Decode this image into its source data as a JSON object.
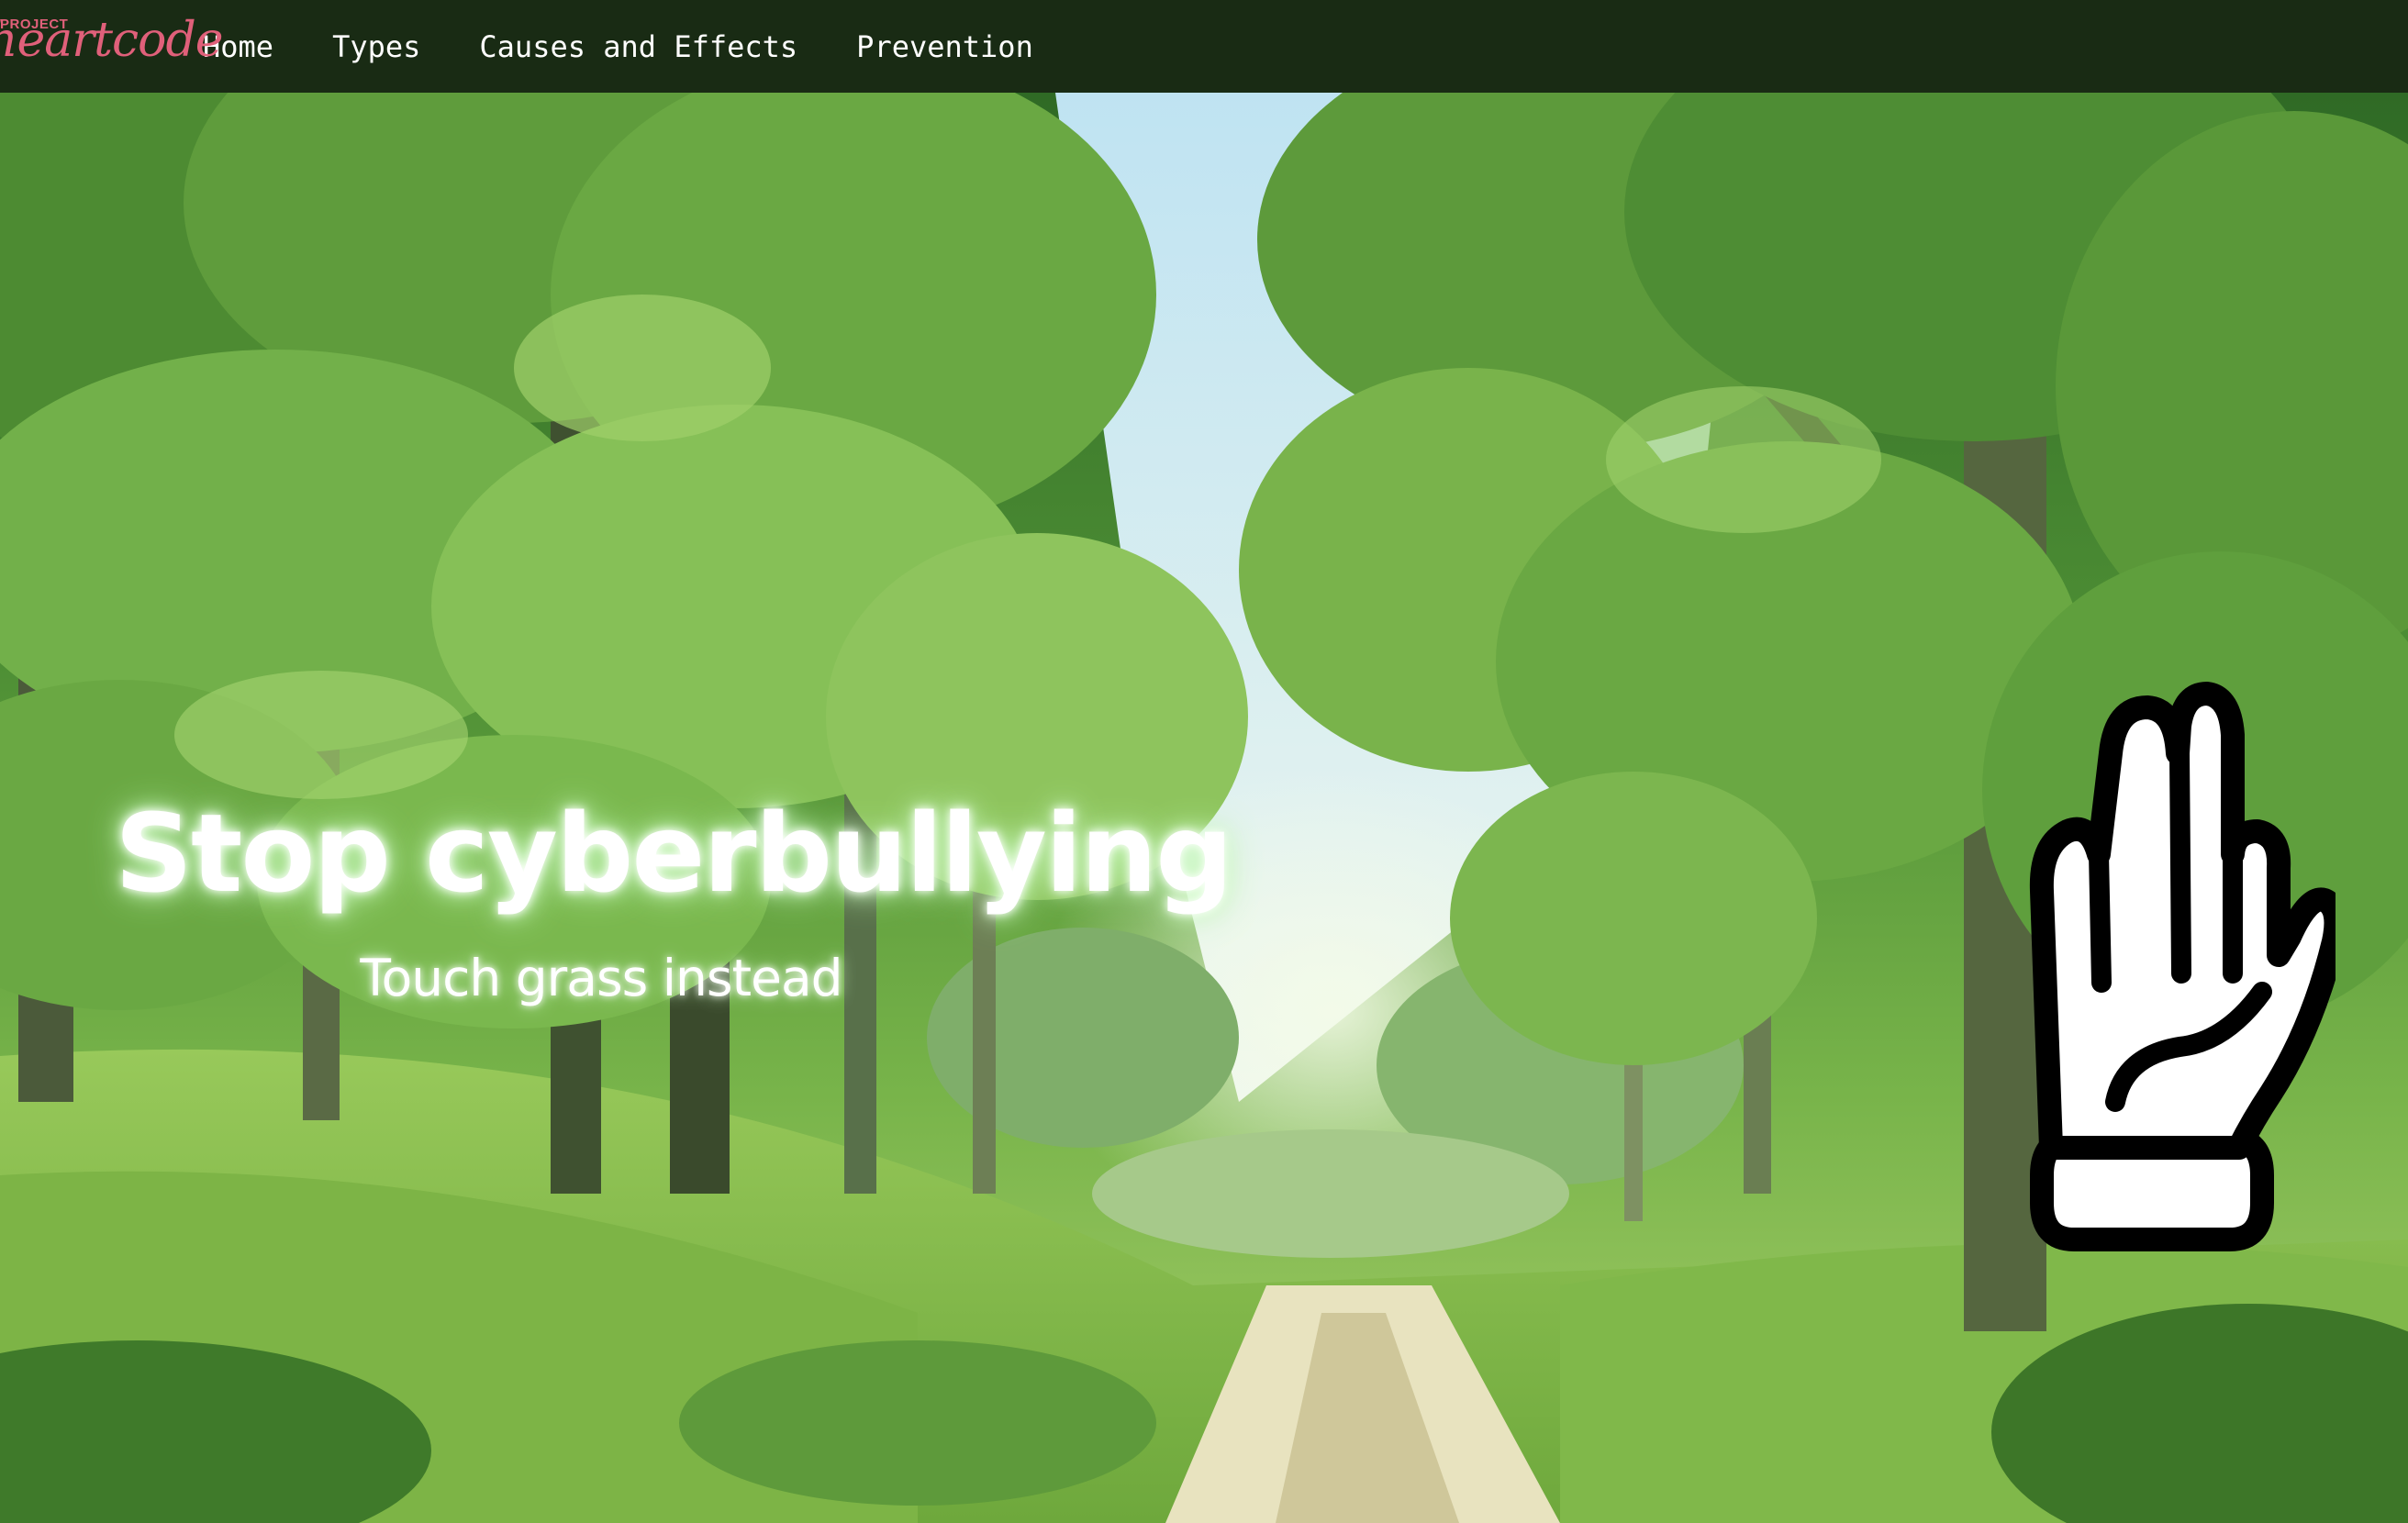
{
  "nav": {
    "logo_small": "PROJECT",
    "logo_main": "heartcode",
    "links": [
      {
        "label": "Home"
      },
      {
        "label": "Types"
      },
      {
        "label": "Causes and Effects"
      },
      {
        "label": "Prevention"
      }
    ]
  },
  "hero": {
    "title": "Stop cyberbullying",
    "subtitle": "Touch grass instead",
    "hand_icon": "stop-hand-icon"
  },
  "colors": {
    "navbar_bg": "#192b14",
    "logo_pink": "#e0607a",
    "nav_text": "#ffffff",
    "hero_text": "#ffffff",
    "forest_green": "#4e8f35"
  }
}
